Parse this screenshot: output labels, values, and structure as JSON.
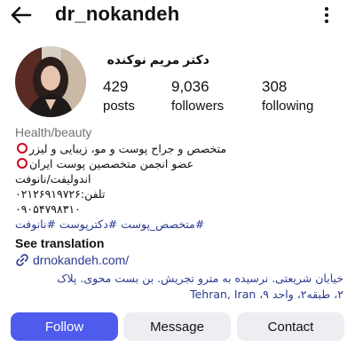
{
  "header": {
    "username": "dr_nokandeh",
    "back_icon": "arrow-left-icon",
    "menu_icon": "more-vertical-icon"
  },
  "profile": {
    "display_name": "دکتر مریم نوکنده",
    "avatar_icon": "profile-photo",
    "stats": {
      "posts": {
        "value": "429",
        "label": "posts"
      },
      "followers": {
        "value": "9,036",
        "label": "followers"
      },
      "following": {
        "value": "308",
        "label": "following"
      }
    }
  },
  "bio": {
    "category": "Health/beauty",
    "line1": "متخصص و جراح پوست و مو، زیبایی و لیزر",
    "line2": "عضو انجمن متخصصین پوست ایران",
    "line3": "اندولیفت/نانوفت",
    "line4": "تلفن:۰۲۱۲۶۹۱۹۷۲۶",
    "line5": "۰۹۰۵۴۷۹۸۳۱۰",
    "hashtags": "#متخصص_پوست #دکترپوست #نانوفت",
    "see_translation": "See translation",
    "link": "drnokandeh.com/",
    "address_line1": "خیابان شریعتی. نرسیده به مترو تجریش. بن بست محوی. پلاک",
    "address_line2": "۲، طبقه۲، واحد ۹، Tehran, Iran",
    "address_line3": "., "
  },
  "actions": {
    "follow": "Follow",
    "message": "Message",
    "contact": "Contact"
  },
  "colors": {
    "accent": "#4f5bec",
    "link": "#2b3a8f",
    "ring": "#d0021b"
  }
}
